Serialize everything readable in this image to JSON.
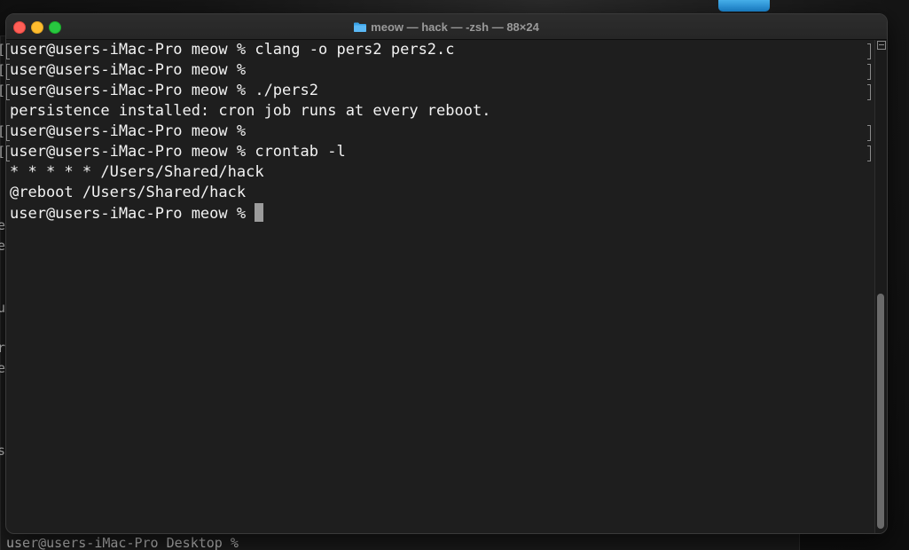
{
  "window": {
    "title": "meow — hack — -zsh — 88×24",
    "folder_icon": "folder-icon"
  },
  "terminal": {
    "lines": [
      "user@users-iMac-Pro meow % clang -o pers2 pers2.c",
      "user@users-iMac-Pro meow %",
      "user@users-iMac-Pro meow % ./pers2",
      "persistence installed: cron job runs at every reboot.",
      "user@users-iMac-Pro meow %",
      "user@users-iMac-Pro meow % crontab -l",
      "* * * * * /Users/Shared/hack",
      "@reboot /Users/Shared/hack",
      "user@users-iMac-Pro meow % "
    ]
  },
  "background_window": {
    "side_fragments": [
      "[",
      "[",
      "[",
      "[",
      "[",
      "e",
      "e",
      "u",
      "r",
      "e",
      "s"
    ],
    "bottom_text": "user@users-iMac-Pro Desktop %"
  },
  "colors": {
    "terminal_bg": "#1e1e1e",
    "text": "#f2f2f2",
    "cursor": "#9c9c9c",
    "close": "#ff5f57",
    "minimize": "#febc2e",
    "maximize": "#28c840"
  }
}
